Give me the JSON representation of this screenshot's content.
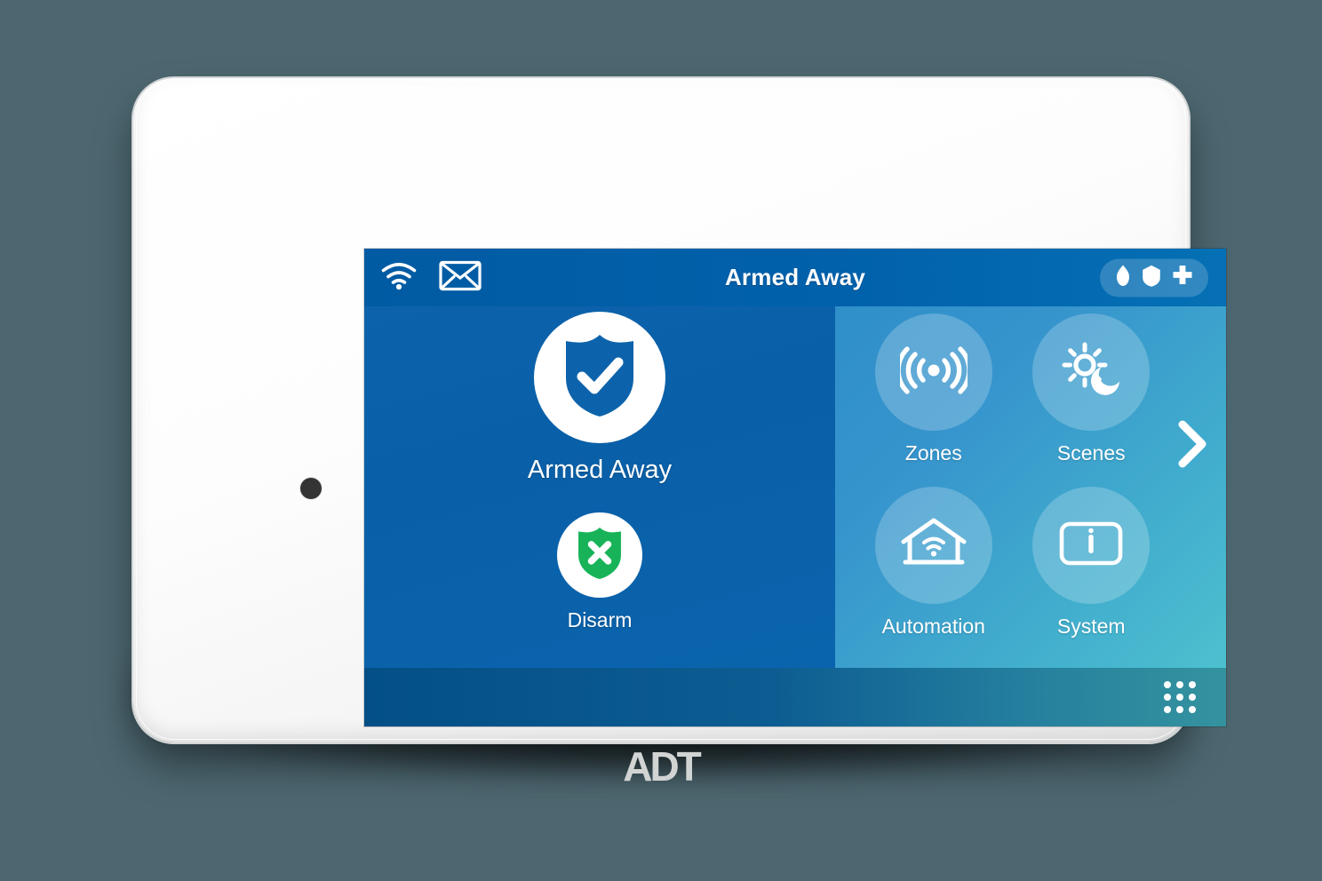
{
  "device": {
    "brand_logo": "ADT",
    "camera_icon": "camera-dot"
  },
  "screen": {
    "statusbar": {
      "wifi_icon": "wifi-icon",
      "mail_icon": "envelope-icon",
      "title": "Armed Away",
      "panic": {
        "fire_icon": "fire-flame-icon",
        "police_icon": "police-badge-icon",
        "medical_icon": "medical-plus-icon"
      }
    },
    "arm_panel": {
      "primary": {
        "label": "Armed Away",
        "icon": "shield-check-icon",
        "icon_color": "#0c63ab",
        "circle_color": "#ffffff"
      },
      "secondary": {
        "label": "Disarm",
        "icon": "shield-x-icon",
        "icon_color": "#18b359",
        "circle_color": "#ffffff"
      }
    },
    "tiles": [
      {
        "label": "Zones",
        "icon": "motion-sensor-icon"
      },
      {
        "label": "Scenes",
        "icon": "sun-moon-icon"
      },
      {
        "label": "Automation",
        "icon": "home-wifi-icon"
      },
      {
        "label": "System",
        "icon": "info-box-icon"
      }
    ],
    "next_page_icon": "chevron-right-icon",
    "bottombar": {
      "keypad_icon": "keypad-grid-icon"
    }
  },
  "colors": {
    "background": "#4d6770",
    "header_blue": "#0161ab",
    "left_panel_blue": "#0a62aa",
    "right_panel_start": "#2f8fc9",
    "right_panel_end": "#4cc0cf",
    "bottombar_start": "#034f86",
    "bottombar_end": "#34939f",
    "disarm_green": "#18b359",
    "logo_gray": "#d2d4d4"
  }
}
